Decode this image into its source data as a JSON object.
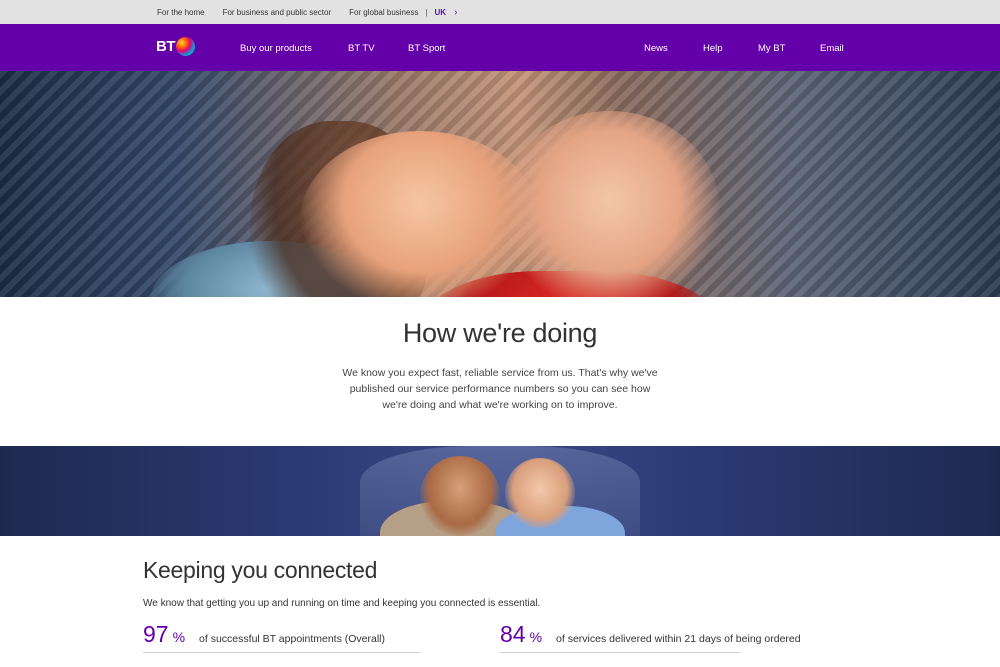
{
  "topbar": {
    "links": [
      "For the home",
      "For business and public sector",
      "For global business"
    ],
    "separator": "|",
    "region": "UK",
    "chevron": "›"
  },
  "nav": {
    "logo_text": "BT",
    "left": [
      "Buy our products",
      "BT TV",
      "BT Sport"
    ],
    "right": [
      "News",
      "Help",
      "My BT",
      "Email"
    ]
  },
  "intro": {
    "title": "How we're doing",
    "body": "We know you expect fast, reliable service from us. That's why we've published our service performance numbers so you can see how we're doing and what we're working on to improve."
  },
  "connected": {
    "title": "Keeping you connected",
    "subtitle": "We know that getting you up and running on time and keeping you connected is essential.",
    "stats": [
      {
        "value": "97",
        "unit": "%",
        "label": "of successful BT appointments (Overall)"
      },
      {
        "value": "84",
        "unit": "%",
        "label": "of services delivered within 21 days of being ordered"
      }
    ]
  },
  "colors": {
    "brand_purple": "#6400aa",
    "topbar_bg": "#e2e2e2",
    "stat_purple": "#6400aa"
  }
}
